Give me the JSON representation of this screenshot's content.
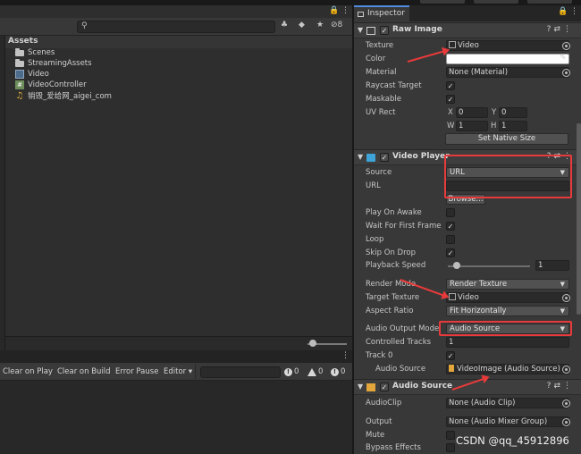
{
  "project": {
    "section_title": "Assets",
    "items": [
      {
        "name": "Scenes",
        "icon": "folder-icon"
      },
      {
        "name": "StreamingAssets",
        "icon": "folder-icon"
      },
      {
        "name": "Video",
        "icon": "render-texture-icon"
      },
      {
        "name": "VideoController",
        "icon": "csharp-script-icon"
      },
      {
        "name": "销毁_爱给网_aigei_com",
        "icon": "audio-clip-icon"
      }
    ],
    "hidden_count": "8"
  },
  "console": {
    "buttons": [
      "Clear on Play",
      "Clear on Build",
      "Error Pause",
      "Editor ▾"
    ],
    "log_count": "0",
    "warn_count": "0",
    "error_count": "0"
  },
  "inspector": {
    "tab_title": "Inspector",
    "raw_image": {
      "title": "Raw Image",
      "texture_label": "Texture",
      "texture_value": "Video",
      "color_label": "Color",
      "material_label": "Material",
      "material_value": "None (Material)",
      "raycast_label": "Raycast Target",
      "maskable_label": "Maskable",
      "uvrect_label": "UV Rect",
      "x_label": "X",
      "x_value": "0",
      "y_label": "Y",
      "y_value": "0",
      "w_label": "W",
      "w_value": "1",
      "h_label": "H",
      "h_value": "1",
      "set_native_size": "Set Native Size"
    },
    "video_player": {
      "title": "Video Player",
      "source_label": "Source",
      "source_value": "URL",
      "url_label": "URL",
      "url_value": "",
      "browse": "Browse...",
      "play_on_awake_label": "Play On Awake",
      "wait_first_frame_label": "Wait For First Frame",
      "loop_label": "Loop",
      "skip_on_drop_label": "Skip On Drop",
      "playback_speed_label": "Playback Speed",
      "playback_speed_value": "1",
      "render_mode_label": "Render Mode",
      "render_mode_value": "Render Texture",
      "target_texture_label": "Target Texture",
      "target_texture_value": "Video",
      "aspect_ratio_label": "Aspect Ratio",
      "aspect_ratio_value": "Fit Horizontally",
      "audio_output_label": "Audio Output Mode",
      "audio_output_value": "Audio Source",
      "controlled_tracks_label": "Controlled Tracks",
      "controlled_tracks_value": "1",
      "track0_label": "Track 0",
      "audio_source_label": "Audio Source",
      "audio_source_value": "VideoImage (Audio Source)"
    },
    "audio_source": {
      "title": "Audio Source",
      "clip_label": "AudioClip",
      "clip_value": "None (Audio Clip)",
      "output_label": "Output",
      "output_value": "None (Audio Mixer Group)",
      "mute_label": "Mute",
      "bypass_label": "Bypass Effects"
    }
  },
  "watermark": "CSDN @qq_45912896",
  "colors": {
    "annotation_red": "#e83a3a",
    "tab_accent": "#4e8de0"
  }
}
